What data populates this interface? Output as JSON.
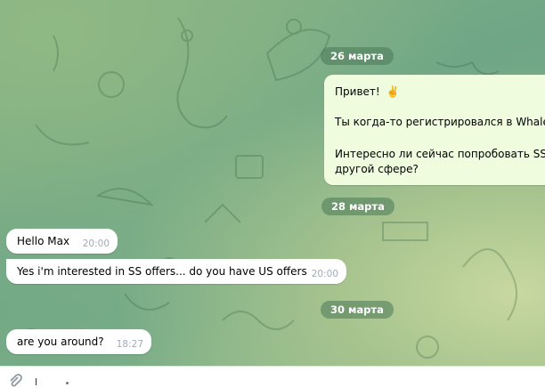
{
  "dates": {
    "d1": "26 марта",
    "d2": "28 марта",
    "d3": "30 марта"
  },
  "outgoing": {
    "line1": "Привет!",
    "emoji": "✌️",
    "line2": "Ты когда-то регистрировался в Whale",
    "line3": "Интересно ли сейчас попробовать SS,",
    "line4": "другой сфере?"
  },
  "incoming": [
    {
      "text": "Hello Max",
      "time": "20:00"
    },
    {
      "text": "Yes i'm interested in SS offers... do you have US offers",
      "time": "20:00"
    },
    {
      "text": "are you around?",
      "time": "18:27"
    }
  ],
  "icons": {
    "attach": "paperclip-icon"
  },
  "colors": {
    "outgoing_bubble": "#effdde",
    "incoming_bubble": "#ffffff",
    "date_pill": "#4a7858"
  }
}
